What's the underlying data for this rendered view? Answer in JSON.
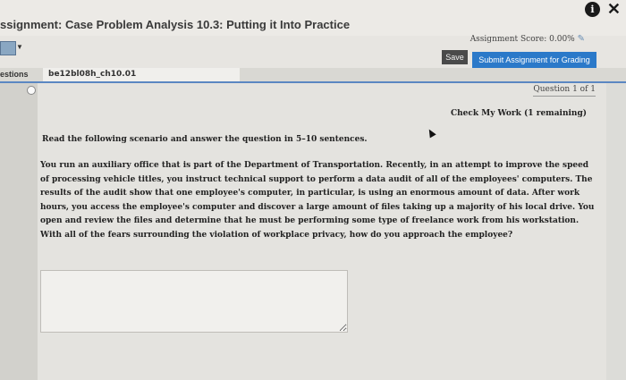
{
  "header": {
    "title": "ssignment: Case Problem Analysis 10.3: Putting it Into Practice",
    "score": "Assignment Score: 0.00%"
  },
  "toolbar": {
    "save_label": "Save",
    "submit_label": "Submit Assignment for Grading"
  },
  "tabs": {
    "questions_label": "estions",
    "active_tab": "be12bl08h_ch10.01"
  },
  "question": {
    "number": "Question 1 of 1",
    "check_work": "Check My Work (1 remaining)",
    "instruction": "Read the following scenario and answer the question in 5–10 sentences.",
    "scenario": "You run an auxiliary office that is part of the Department of Transportation. Recently, in an attempt to improve the speed of processing vehicle titles, you instruct technical support to perform a data audit of all of the employees' computers. The results of the audit show that one employee's computer, in particular, is using an enormous amount of data. After work hours, you access the employee's computer and discover a large amount of files taking up a majority of his local drive. You open and review the files and determine that he must be performing some type of freelance work from his workstation. With all of the fears surrounding the violation of workplace privacy, how do you approach the employee?"
  },
  "icons": {
    "info": "i",
    "close": "✕",
    "pencil": "✎"
  },
  "colors": {
    "accent": "#2b79c9",
    "save_bg": "#4a4a4a"
  }
}
